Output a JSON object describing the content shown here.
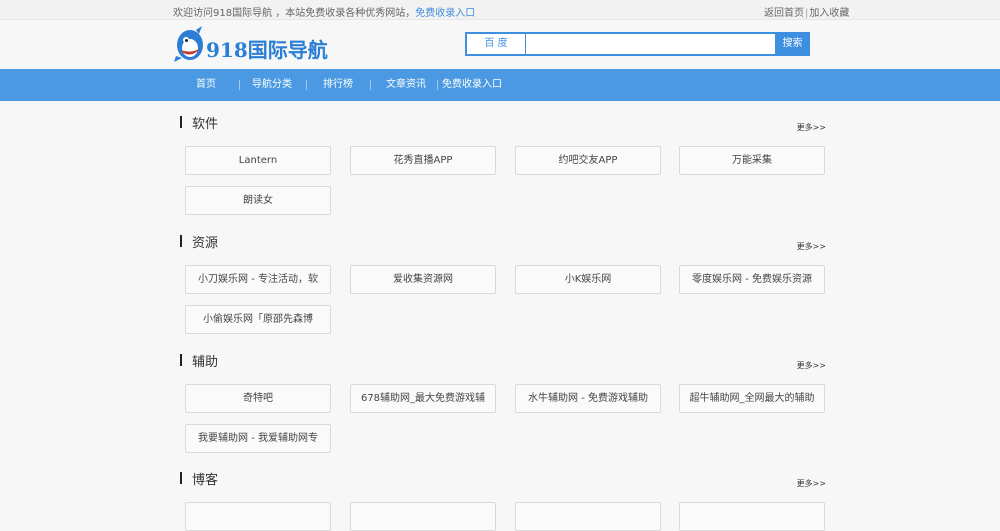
{
  "topbar": {
    "welcome": "欢迎访问918国际导航 ，本站免费收录各种优秀网站，",
    "welcome_link": "免费收录入口",
    "back_home": "返回首页",
    "sep": "|",
    "add_fav": "加入收藏"
  },
  "header": {
    "logo_text": "918国际导航",
    "search": {
      "engine": "百 度",
      "placeholder": "",
      "button": "搜索"
    }
  },
  "nav": {
    "items": [
      "首页",
      "导航分类",
      "排行榜",
      "文章资讯",
      "免费收录入口"
    ]
  },
  "sections": [
    {
      "title": "软件",
      "more": "更多>>",
      "items": [
        "Lantern",
        "花秀直播APP",
        "约吧交友APP",
        "万能采集",
        "朗读女"
      ]
    },
    {
      "title": "资源",
      "more": "更多>>",
      "items": [
        "小刀娱乐网 - 专注活动，软",
        "爱收集资源网",
        "小K娱乐网",
        "零度娱乐网 - 免费娱乐资源",
        "小偷娱乐网「原邵先森博"
      ]
    },
    {
      "title": "辅助",
      "more": "更多>>",
      "items": [
        "奇特吧",
        "678辅助网_最大免费游戏辅",
        "水牛辅助网 - 免费游戏辅助",
        "超牛辅助网_全网最大的辅助",
        "我要辅助网 - 我爱辅助网专"
      ]
    },
    {
      "title": "博客",
      "more": "更多>>",
      "items": []
    }
  ],
  "colors": {
    "accent": "#4a99e2",
    "link": "#3f8fe0"
  }
}
